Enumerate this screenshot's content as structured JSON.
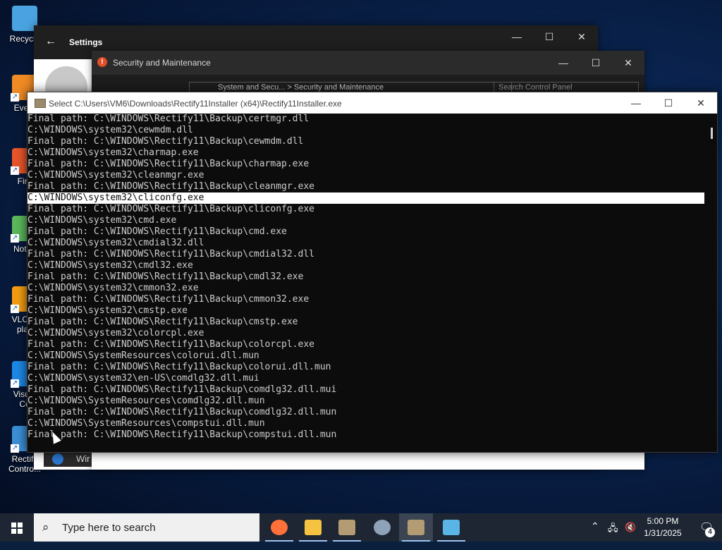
{
  "desktop": {
    "icons": [
      {
        "label": "Recycle",
        "icon": "recycle-bin-icon"
      },
      {
        "label": "Every",
        "icon": "everything-search-icon"
      },
      {
        "label": "Fire",
        "icon": "firefox-icon"
      },
      {
        "label": "Notep",
        "icon": "notepad-icon"
      },
      {
        "label": "VLC m\nplay",
        "icon": "vlc-icon"
      },
      {
        "label": "Visual\nCo",
        "icon": "vscode-icon"
      },
      {
        "label": "Rectify\nContro...",
        "icon": "rectify-control-panel-icon"
      }
    ]
  },
  "settings_window": {
    "title": "Settings",
    "back_glyph": "←",
    "minimize": "—",
    "maximize": "☐",
    "close": "✕"
  },
  "security_window": {
    "title": "Security and Maintenance",
    "address": "System and Secu...  >  Security and Maintenance",
    "search_placeholder": "Search Control Panel",
    "minimize": "—",
    "maximize": "☐",
    "close": "✕",
    "partial_taskbar_text": "Wir"
  },
  "console_window": {
    "title": "Select C:\\Users\\VM6\\Downloads\\Rectify11Installer (x64)\\Rectify11Installer.exe",
    "minimize": "—",
    "maximize": "☐",
    "close": "✕",
    "lines": [
      "Final path: C:\\WINDOWS\\Rectify11\\Backup\\certmgr.dll",
      "C:\\WINDOWS\\system32\\cewmdm.dll",
      "Final path: C:\\WINDOWS\\Rectify11\\Backup\\cewmdm.dll",
      "C:\\WINDOWS\\system32\\charmap.exe",
      "Final path: C:\\WINDOWS\\Rectify11\\Backup\\charmap.exe",
      "C:\\WINDOWS\\system32\\cleanmgr.exe",
      "Final path: C:\\WINDOWS\\Rectify11\\Backup\\cleanmgr.exe",
      "C:\\WINDOWS\\system32\\cliconfg.exe",
      "Final path: C:\\WINDOWS\\Rectify11\\Backup\\cliconfg.exe",
      "C:\\WINDOWS\\system32\\cmd.exe",
      "Final path: C:\\WINDOWS\\Rectify11\\Backup\\cmd.exe",
      "C:\\WINDOWS\\system32\\cmdial32.dll",
      "Final path: C:\\WINDOWS\\Rectify11\\Backup\\cmdial32.dll",
      "C:\\WINDOWS\\system32\\cmdl32.exe",
      "Final path: C:\\WINDOWS\\Rectify11\\Backup\\cmdl32.exe",
      "C:\\WINDOWS\\system32\\cmmon32.exe",
      "Final path: C:\\WINDOWS\\Rectify11\\Backup\\cmmon32.exe",
      "C:\\WINDOWS\\system32\\cmstp.exe",
      "Final path: C:\\WINDOWS\\Rectify11\\Backup\\cmstp.exe",
      "C:\\WINDOWS\\system32\\colorcpl.exe",
      "Final path: C:\\WINDOWS\\Rectify11\\Backup\\colorcpl.exe",
      "C:\\WINDOWS\\SystemResources\\colorui.dll.mun",
      "Final path: C:\\WINDOWS\\Rectify11\\Backup\\colorui.dll.mun",
      "C:\\WINDOWS\\system32\\en-US\\comdlg32.dll.mui",
      "Final path: C:\\WINDOWS\\Rectify11\\Backup\\comdlg32.dll.mui",
      "C:\\WINDOWS\\SystemResources\\comdlg32.dll.mun",
      "Final path: C:\\WINDOWS\\Rectify11\\Backup\\comdlg32.dll.mun",
      "C:\\WINDOWS\\SystemResources\\compstui.dll.mun",
      "Final path: C:\\WINDOWS\\Rectify11\\Backup\\compstui.dll.mun"
    ],
    "selected_line_index": 7
  },
  "taskbar": {
    "search_placeholder": "Type here to search",
    "apps": [
      {
        "name": "firefox-icon",
        "active": false
      },
      {
        "name": "file-explorer-icon",
        "active": false
      },
      {
        "name": "installer-package-icon",
        "active": false
      },
      {
        "name": "settings-gear-icon",
        "active": false
      },
      {
        "name": "installer-package-icon",
        "active": true
      },
      {
        "name": "control-panel-icon",
        "active": false
      }
    ],
    "time": "5:00 PM",
    "date": "1/31/2025",
    "notification_count": "4",
    "colors": {
      "taskbar_bg": "#1e2633",
      "accent": "#9ec3f0"
    }
  }
}
